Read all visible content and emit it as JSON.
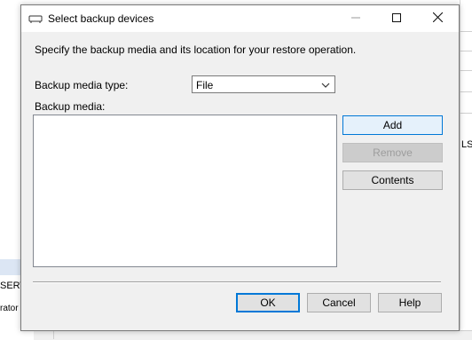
{
  "background": {
    "right_text": "LS",
    "left_text_1": "SERV",
    "left_text_2": "rator"
  },
  "dialog": {
    "title": "Select backup devices",
    "instruction": "Specify the backup media and its location for your restore operation.",
    "media_type_label": "Backup media type:",
    "media_type_value": "File",
    "media_label": "Backup media:",
    "media_items": [],
    "buttons": {
      "add": "Add",
      "remove": "Remove",
      "contents": "Contents",
      "ok": "OK",
      "cancel": "Cancel",
      "help": "Help"
    }
  },
  "colors": {
    "accent": "#0078d7",
    "dialog_bg": "#f0f0f0",
    "disabled_text": "#9d9d9d"
  },
  "icons": {
    "title": "backup-device-icon",
    "minimize": "minimize-icon",
    "maximize": "maximize-icon",
    "close": "close-icon",
    "dropdown": "chevron-down-icon"
  }
}
